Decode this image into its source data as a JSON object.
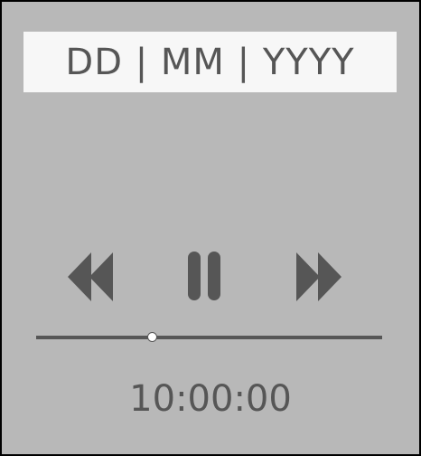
{
  "date_display": "DD | MM | YYYY",
  "time_display": "10:00:00",
  "playback": {
    "progress": 0.338,
    "state": "playing"
  },
  "icons": {
    "rewind": "rewind-icon",
    "pause": "pause-icon",
    "fast_forward": "fast-forward-icon"
  },
  "colors": {
    "panel": "#b8b8b8",
    "date_box": "#f7f7f7",
    "foreground": "#565656",
    "thumb_fill": "#ffffff"
  }
}
